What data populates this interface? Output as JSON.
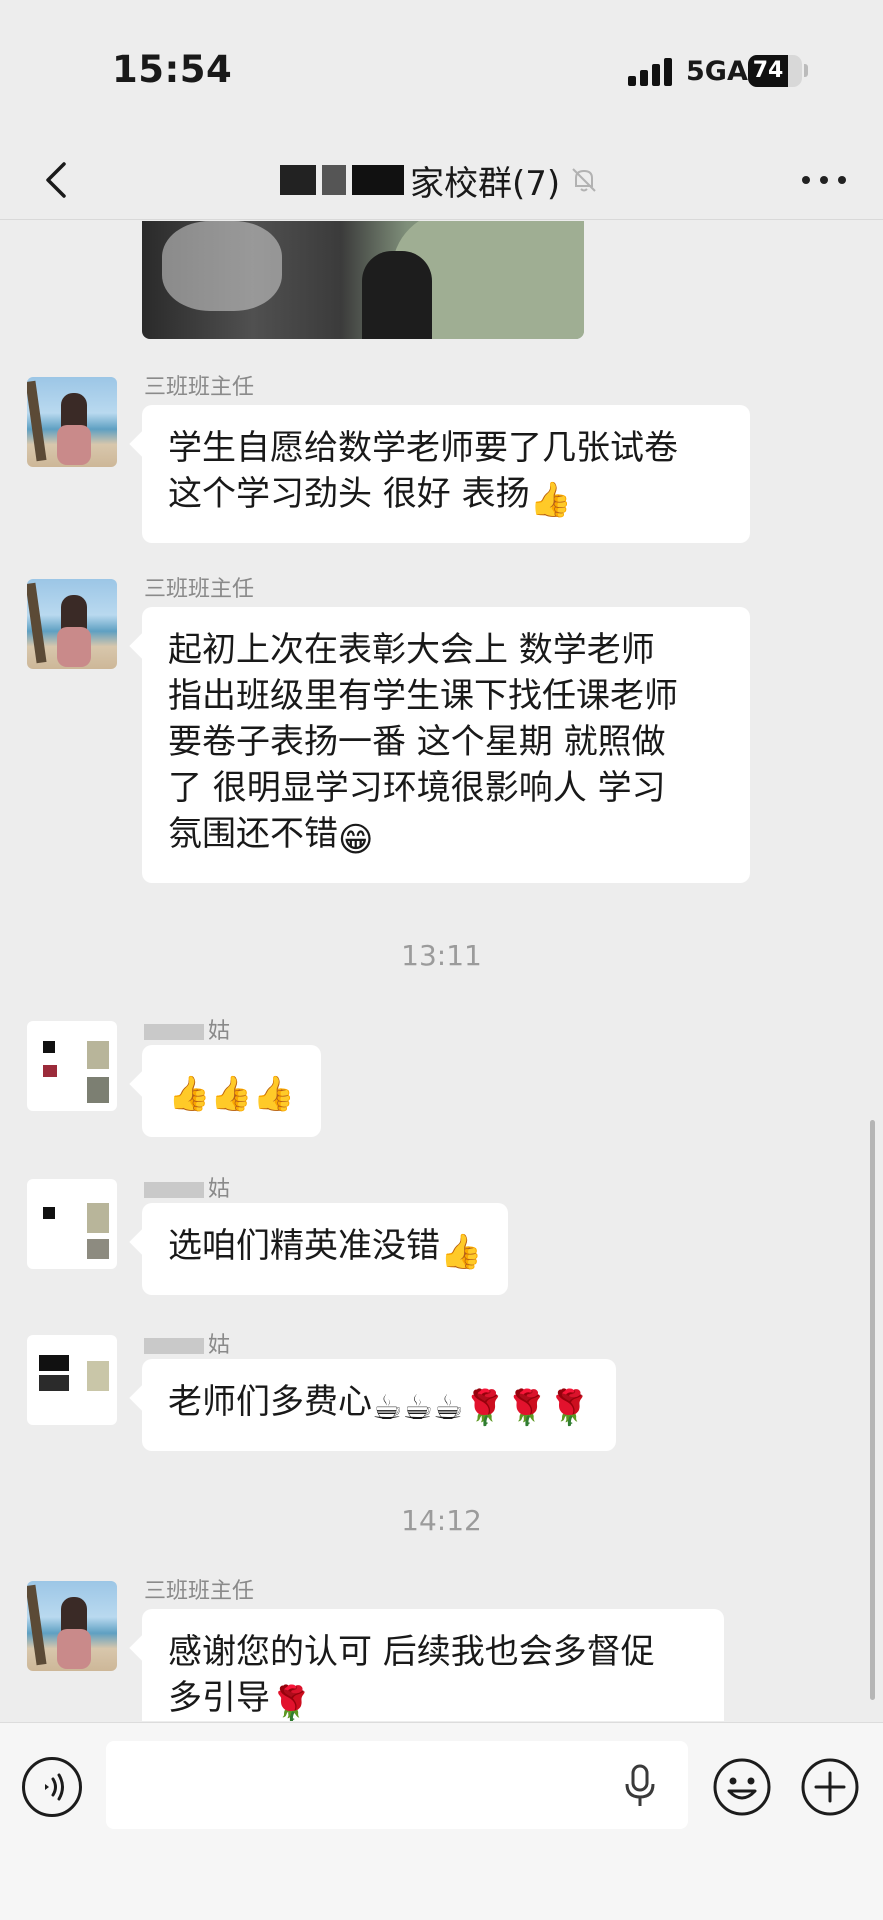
{
  "status_bar": {
    "time": "15:54",
    "network": "5GA",
    "battery": "74",
    "battery_level": 0.74
  },
  "nav": {
    "title": "家校群(7)",
    "title_visible_fragment": "家校群(7)",
    "back_icon": "chevron-left-icon",
    "mute_icon": "bell-muted-icon",
    "more_icon": "more-dots-icon"
  },
  "chat": {
    "messages": [
      {
        "type": "image",
        "sender": "",
        "content": ""
      },
      {
        "type": "text",
        "sender": "三班班主任",
        "text": "学生自愿给数学老师要了几张试卷这个学习劲头 很好 表扬👍"
      },
      {
        "type": "text",
        "sender": "三班班主任",
        "text": "起初上次在表彰大会上 数学老师指出班级里有学生课下找任课老师要卷子表扬一番 这个星期 就照做了 很明显学习环境很影响人 学习氛围还不错😁"
      },
      {
        "type": "time",
        "text": "13:11"
      },
      {
        "type": "text",
        "sender": "姑",
        "text": "👍👍👍"
      },
      {
        "type": "text",
        "sender": "姑",
        "text": "选咱们精英准没错👍"
      },
      {
        "type": "text",
        "sender": "姑",
        "text": "老师们多费心☕☕☕🌹🌹🌹"
      },
      {
        "type": "time",
        "text": "14:12"
      },
      {
        "type": "text",
        "sender": "三班班主任",
        "text": "感谢您的认可 后续我也会多督促多引导🌹"
      }
    ],
    "labels": {
      "t1311": "13:11",
      "t1412": "14:12",
      "sender_teacher": "三班班主任",
      "sender_parent_suffix": "姑",
      "msg1_line1": "学生自愿给数学老师要了几张试卷",
      "msg1_line2": "这个学习劲头 很好 表扬",
      "msg2_line1": "起初上次在表彰大会上 数学老师",
      "msg2_line2": "指出班级里有学生课下找任课老师",
      "msg2_line3": "要卷子表扬一番 这个星期 就照做",
      "msg2_line4": "了 很明显学习环境很影响人 学习",
      "msg2_line5": "氛围还不错",
      "msg4_text": "选咱们精英准没错",
      "msg5_text": "老师们多费心",
      "msg6_line1": "感谢您的认可 后续我也会多督促",
      "msg6_line2": "多引导"
    }
  },
  "input_bar": {
    "voice_icon": "voice-wave-icon",
    "mic_icon": "microphone-icon",
    "emoji_icon": "smiley-icon",
    "plus_icon": "plus-circle-icon",
    "input_value": "",
    "input_placeholder": ""
  },
  "colors": {
    "background": "#ededed",
    "bubble": "#ffffff",
    "text": "#191919",
    "secondary_text": "#8a8a8a"
  }
}
